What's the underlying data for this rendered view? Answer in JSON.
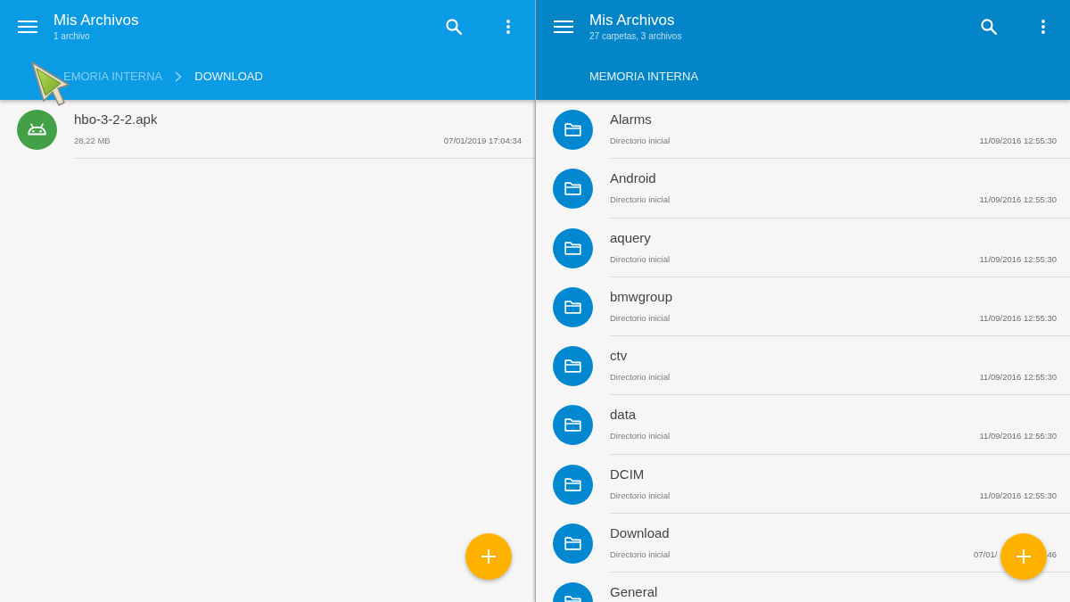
{
  "panes": [
    {
      "active": false,
      "title": "Mis Archivos",
      "subtitle": "1 archivo",
      "breadcrumb": [
        {
          "label": "EMORIA INTERNA",
          "selected": false
        },
        {
          "label": "DOWNLOAD",
          "selected": true
        }
      ],
      "items": [
        {
          "kind": "apk",
          "name": "hbo-3-2-2.apk",
          "detail": "28,22 MB",
          "date": "07/01/2019 17:04:34"
        }
      ]
    },
    {
      "active": true,
      "title": "Mis Archivos",
      "subtitle": "27 carpetas, 3 archivos",
      "breadcrumb": [
        {
          "label": "MEMORIA INTERNA",
          "selected": true
        }
      ],
      "items": [
        {
          "kind": "folder",
          "name": "Alarms",
          "detail": "Directorio inicial",
          "date": "11/09/2016 12:55:30"
        },
        {
          "kind": "folder",
          "name": "Android",
          "detail": "Directorio inicial",
          "date": "11/09/2016 12:55:30"
        },
        {
          "kind": "folder",
          "name": "aquery",
          "detail": "Directorio inicial",
          "date": "11/09/2016 12:55:30"
        },
        {
          "kind": "folder",
          "name": "bmwgroup",
          "detail": "Directorio inicial",
          "date": "11/09/2016 12:55:30"
        },
        {
          "kind": "folder",
          "name": "ctv",
          "detail": "Directorio inicial",
          "date": "11/09/2016 12:55:30"
        },
        {
          "kind": "folder",
          "name": "data",
          "detail": "Directorio inicial",
          "date": "11/09/2016 12:55:30"
        },
        {
          "kind": "folder",
          "name": "DCIM",
          "detail": "Directorio inicial",
          "date": "11/09/2016 12:55:30"
        },
        {
          "kind": "folder",
          "name": "Download",
          "detail": "Directorio inicial",
          "date": "07/01/",
          "date_end": "46"
        },
        {
          "kind": "folder",
          "name": "General"
        }
      ]
    }
  ]
}
